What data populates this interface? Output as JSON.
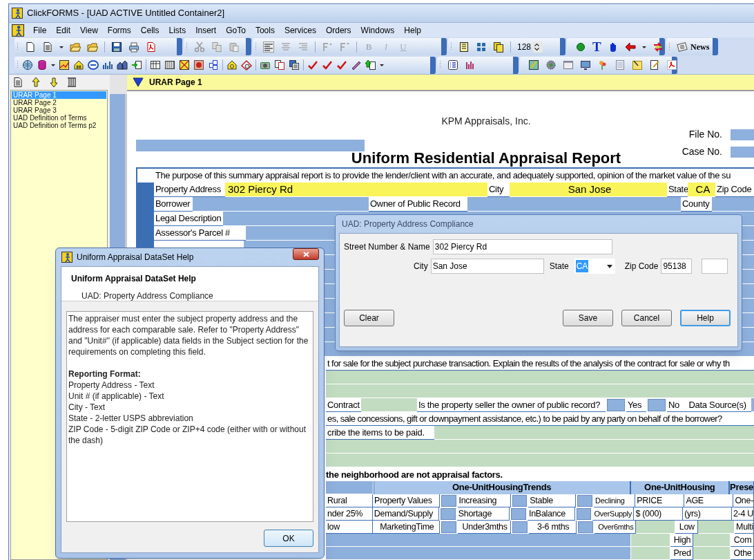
{
  "window": {
    "title": "ClickFORMS - [UAD ACTIVE Untitled Container2]"
  },
  "menu": [
    {
      "label": "File"
    },
    {
      "label": "Edit"
    },
    {
      "label": "View"
    },
    {
      "label": "Forms"
    },
    {
      "label": "Cells"
    },
    {
      "label": "Lists"
    },
    {
      "label": "Insert"
    },
    {
      "label": "GoTo"
    },
    {
      "label": "Tools"
    },
    {
      "label": "Services"
    },
    {
      "label": "Orders"
    },
    {
      "label": "Windows"
    },
    {
      "label": "Help"
    }
  ],
  "toolbar": {
    "format_buttons": [
      {
        "label": "B",
        "disabled": true
      },
      {
        "label": "I",
        "disabled": true
      },
      {
        "label": "U",
        "disabled": true
      }
    ],
    "zoom": "128",
    "text_tool": "T",
    "news_button": "News"
  },
  "forms_list": [
    {
      "label": "URAR Page 1",
      "selected": true
    },
    {
      "label": "URAR Page 2",
      "selected": false
    },
    {
      "label": "URAR Page 3",
      "selected": false
    },
    {
      "label": "UAD Definition of Terms",
      "selected": false
    },
    {
      "label": "UAD Definition of Terms p2",
      "selected": false
    }
  ],
  "page_header": {
    "title": "URAR Page 1"
  },
  "form": {
    "company": "KPM Appraisals, Inc.",
    "file_no_label": "File No.",
    "case_no_label": "Case No.",
    "title": "Uniform Residential Appraisal Report",
    "purpose": "The purpose of this summary appraisal report is to provide the lender/client with an accurate, and adequately supported, opinion of the market value of the su",
    "top_rows": [
      [
        {
          "kind": "label",
          "text": "Property  Address"
        },
        {
          "kind": "field",
          "text": "302 Piercy Rd",
          "color": "#f8f45a"
        },
        {
          "kind": "label",
          "text": "City"
        },
        {
          "kind": "field",
          "text": "San Jose",
          "color": "#f8f45a"
        },
        {
          "kind": "label",
          "text": "State"
        },
        {
          "kind": "field",
          "text": "CA",
          "color": "#f8f45a"
        },
        {
          "kind": "label",
          "text": "Zip Code"
        }
      ],
      [
        {
          "kind": "label",
          "text": "Borrower"
        },
        {
          "kind": "field",
          "color": "#8eb0dc"
        },
        {
          "kind": "label",
          "text": "Owner of Public Record"
        },
        {
          "kind": "field",
          "color": "#8eb0dc"
        },
        {
          "kind": "label",
          "text": "County"
        },
        {
          "kind": "field",
          "color": "#8eb0dc"
        }
      ],
      [
        {
          "kind": "label",
          "text": "Legal Description"
        },
        {
          "kind": "field",
          "color": "#8eb0dc"
        }
      ],
      [
        {
          "kind": "label",
          "text": "Assessor's Parcel #"
        },
        {
          "kind": "field",
          "color": "#8eb0dc"
        }
      ],
      [
        {
          "kind": "spacer"
        },
        {
          "kind": "field",
          "color": "#8eb0dc"
        }
      ],
      [
        {
          "kind": "field",
          "color": "#8eb0dc"
        }
      ],
      [
        {
          "kind": "field",
          "color": "#8eb0dc"
        }
      ],
      [
        {
          "kind": "field",
          "color": "#8eb0dc"
        }
      ],
      [
        {
          "kind": "field",
          "color": "#8eb0dc"
        }
      ],
      [
        {
          "kind": "field",
          "color": "#8eb0dc"
        }
      ],
      [
        {
          "kind": "field",
          "color": "#8eb0dc"
        }
      ],
      [
        {
          "kind": "field",
          "color": "#8eb0dc"
        }
      ]
    ],
    "lower_rows": [
      [
        {
          "kind": "label",
          "text": "t for sale for the subject purchase transaction. Explain the results of the analysis of the contract for sale or why th"
        }
      ],
      [
        {
          "kind": "field",
          "color": "#c2dcc2"
        }
      ],
      [
        {
          "kind": "field",
          "color": "#c2dcc2"
        }
      ],
      [
        {
          "kind": "label",
          "text": "Contract"
        },
        {
          "kind": "field",
          "color": "#c2dcc2"
        },
        {
          "kind": "label",
          "text": "Is the property seller the owner of public record?"
        },
        {
          "kind": "check",
          "checked": false
        },
        {
          "kind": "label",
          "text": "Yes"
        },
        {
          "kind": "check",
          "checked": false
        },
        {
          "kind": "label",
          "text": "No"
        },
        {
          "kind": "label",
          "text": "Data Source(s)"
        },
        {
          "kind": "field",
          "color": "#8eb0dc"
        }
      ],
      [
        {
          "kind": "label",
          "text": "es, sale concessions, gift or downpayment assistance, etc.) to be paid by any party on behalf of the borrower?"
        }
      ],
      [
        {
          "kind": "label",
          "text": "cribe the items to be paid."
        },
        {
          "kind": "field",
          "color": "#c2dcc2"
        }
      ],
      [
        {
          "kind": "field",
          "color": "#c2dcc2"
        }
      ],
      [
        {
          "kind": "field",
          "color": "#c2dcc2"
        }
      ],
      [
        {
          "kind": "heading",
          "text": "the neighborhood are not appraisal factors."
        }
      ]
    ],
    "trends_table": [
      [
        {
          "kind": "field",
          "color": "#8eb0dc"
        },
        {
          "kind": "heading",
          "text": "One-UnitHousingTrends"
        },
        {
          "kind": "heading",
          "text": "One-UnitHousing"
        },
        {
          "kind": "heading",
          "text": "Prese"
        }
      ],
      [
        {
          "kind": "label",
          "text": "Rural"
        },
        {
          "kind": "label",
          "text": "Property Values"
        },
        {
          "kind": "check",
          "checked": false
        },
        {
          "kind": "label",
          "text": "Increasing"
        },
        {
          "kind": "check",
          "checked": false
        },
        {
          "kind": "label",
          "text": "Stable"
        },
        {
          "kind": "check",
          "checked": false
        },
        {
          "kind": "label",
          "text": "Declining"
        },
        {
          "kind": "label",
          "text": "PRICE"
        },
        {
          "kind": "label",
          "text": "AGE"
        },
        {
          "kind": "label",
          "text": "One-"
        }
      ],
      [
        {
          "kind": "label",
          "text": "nder 25%"
        },
        {
          "kind": "label",
          "text": "Demand/Supply"
        },
        {
          "kind": "check",
          "checked": false
        },
        {
          "kind": "label",
          "text": "Shortage"
        },
        {
          "kind": "check",
          "checked": false
        },
        {
          "kind": "label",
          "text": "InBalance"
        },
        {
          "kind": "check",
          "checked": false
        },
        {
          "kind": "label",
          "text": "OverSupply"
        },
        {
          "kind": "label",
          "text": "$ (000)"
        },
        {
          "kind": "label",
          "text": "(yrs)"
        },
        {
          "kind": "label",
          "text": "2-4 U"
        }
      ],
      [
        {
          "kind": "label",
          "text": "low"
        },
        {
          "kind": "label",
          "text": "MarketingTime"
        },
        {
          "kind": "check",
          "checked": false
        },
        {
          "kind": "label",
          "text": "Under3mths"
        },
        {
          "kind": "check",
          "checked": false
        },
        {
          "kind": "label",
          "text": "3-6 mths"
        },
        {
          "kind": "check",
          "checked": false
        },
        {
          "kind": "label",
          "text": "Over6mths"
        },
        {
          "kind": "field",
          "color": "#c2dcc2"
        },
        {
          "kind": "label",
          "text": "Low"
        },
        {
          "kind": "field",
          "color": "#c2dcc2"
        },
        {
          "kind": "label",
          "text": "Multi"
        }
      ],
      [
        {
          "kind": "field",
          "color": "#8eb0dc"
        },
        {
          "kind": "field",
          "color": "#c2dcc2"
        },
        {
          "kind": "label",
          "text": "High"
        },
        {
          "kind": "field",
          "color": "#c2dcc2"
        },
        {
          "kind": "label",
          "text": "Com"
        }
      ],
      [
        {
          "kind": "field",
          "color": "#8eb0dc"
        },
        {
          "kind": "field",
          "color": "#c2dcc2"
        },
        {
          "kind": "label",
          "text": "Pred"
        },
        {
          "kind": "field",
          "color": "#c2dcc2"
        },
        {
          "kind": "label",
          "text": "Othe"
        }
      ]
    ]
  },
  "address_dialog": {
    "title": "UAD: Property Address Compliance",
    "street_label": "Street Number & Name",
    "street": "302 Piercy Rd",
    "city_label": "City",
    "city": "San Jose",
    "state_label": "State",
    "state": "CA",
    "state_text_selected": true,
    "zip_label": "Zip Code",
    "zip": "95138",
    "buttons": [
      {
        "label": "Clear",
        "focused": false
      },
      {
        "label": "Save",
        "focused": false
      },
      {
        "label": "Cancel",
        "focused": false
      },
      {
        "label": "Help",
        "focused": true
      }
    ]
  },
  "help_window": {
    "title": "Uniform Appraisal DataSet Help",
    "heading": "Uniform Appraisal DataSet Help",
    "subheading": "UAD: Property Address Compliance",
    "body": "The appraiser must enter the subject property address and the address for each comparable sale. Refer to \"Property Address\" and \"Unit#\" (if applicable) data fields in the Subject section for the requirements on completing this field.",
    "format_heading": "Reporting Format:",
    "format_lines": [
      "Property Address - Text",
      "Unit # (if applicable) - Text",
      "City - Text",
      "State - 2-letter USPS abbreviation",
      "ZIP Code - 5-digit ZIP Code or ZIP+4 code (either with or without the dash)"
    ],
    "ok_button": "OK"
  }
}
